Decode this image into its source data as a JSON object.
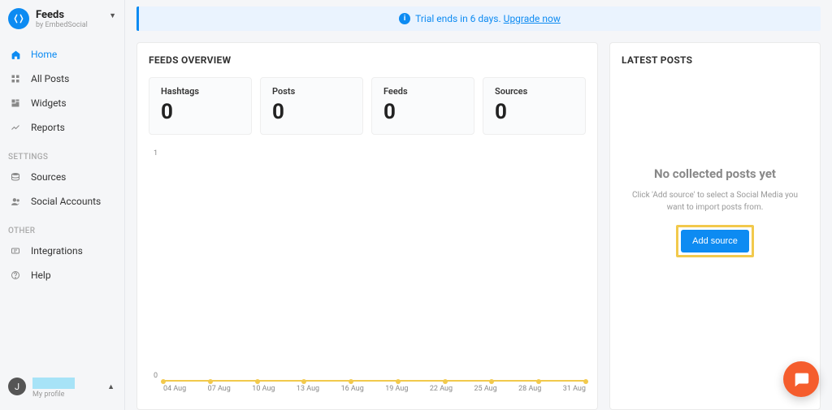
{
  "brand": {
    "name": "Feeds",
    "by": "by EmbedSocial"
  },
  "nav": {
    "home": "Home",
    "allPosts": "All Posts",
    "widgets": "Widgets",
    "reports": "Reports",
    "settingsHeader": "SETTINGS",
    "sources": "Sources",
    "socialAccounts": "Social Accounts",
    "otherHeader": "OTHER",
    "integrations": "Integrations",
    "help": "Help"
  },
  "profile": {
    "initial": "J",
    "label": "My profile"
  },
  "trial": {
    "textA": "Trial ends in 6 days.",
    "link": "Upgrade now"
  },
  "overview": {
    "title": "FEEDS OVERVIEW",
    "stats": [
      {
        "label": "Hashtags",
        "value": "0"
      },
      {
        "label": "Posts",
        "value": "0"
      },
      {
        "label": "Feeds",
        "value": "0"
      },
      {
        "label": "Sources",
        "value": "0"
      }
    ]
  },
  "latest": {
    "title": "LATEST POSTS",
    "emptyTitle": "No collected posts yet",
    "emptyDesc": "Click 'Add source' to select a Social Media you want to import posts from.",
    "addSource": "Add source"
  },
  "chart_data": {
    "type": "line",
    "categories": [
      "04 Aug",
      "07 Aug",
      "10 Aug",
      "13 Aug",
      "16 Aug",
      "19 Aug",
      "22 Aug",
      "25 Aug",
      "28 Aug",
      "31 Aug"
    ],
    "values": [
      0,
      0,
      0,
      0,
      0,
      0,
      0,
      0,
      0,
      0
    ],
    "title": "",
    "xlabel": "",
    "ylabel": "",
    "ylim": [
      0,
      1
    ]
  }
}
